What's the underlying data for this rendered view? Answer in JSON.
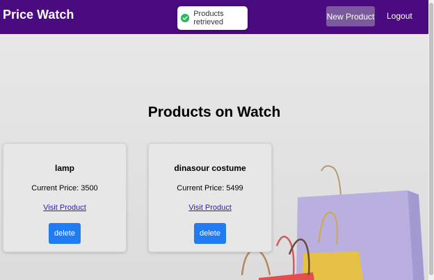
{
  "app": {
    "title": "Price Watch"
  },
  "navbar": {
    "new_product_label": "New Product",
    "logout_label": "Logout"
  },
  "toast": {
    "message": "Products retrieved",
    "icon": "check-circle-icon",
    "color": "#2eb85c"
  },
  "main": {
    "heading": "Products on Watch",
    "products": [
      {
        "name": "lamp",
        "price_text": "Current Price: 3500",
        "link_label": "Visit Product",
        "delete_label": "delete"
      },
      {
        "name": "dinasour costume",
        "price_text": "Current Price: 5499",
        "link_label": "Visit Product",
        "delete_label": "delete"
      }
    ]
  },
  "colors": {
    "navbar": "#4a0a80",
    "new_product_button": "#7a5a9c",
    "delete_button": "#1f7cf2",
    "link": "#2a1fa8"
  },
  "decor": {
    "image": "shopping-bags-illustration"
  }
}
